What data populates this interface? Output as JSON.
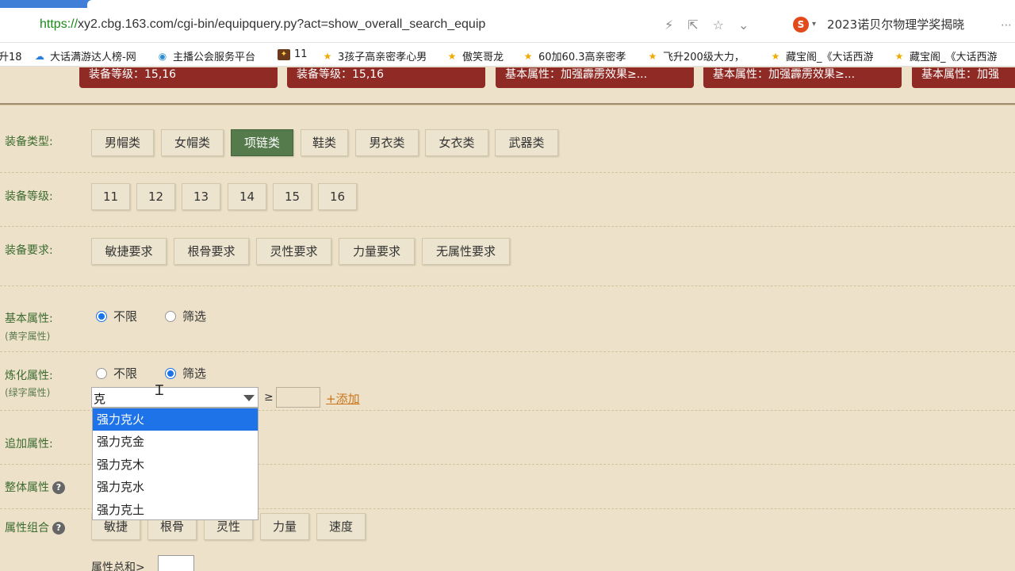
{
  "browser": {
    "url_proto": "https://",
    "url_rest": "xy2.cbg.163.com/cgi-bin/equipquery.py?act=show_overall_search_equip",
    "search_text": "2023诺贝尔物理学奖揭晓",
    "bookmarks": [
      {
        "icon": "cloud-icon",
        "label": "大话满游达人榜-网"
      },
      {
        "icon": "globe-icon",
        "label": "主播公会服务平台"
      },
      {
        "icon": "game-icon",
        "label": "11"
      },
      {
        "icon": "star-icon",
        "label": "3孩子高亲密孝心男"
      },
      {
        "icon": "star-icon",
        "label": "傲笑哥龙"
      },
      {
        "icon": "star-icon",
        "label": "60加60.3高亲密孝"
      },
      {
        "icon": "star-icon",
        "label": "飞升200级大力，"
      },
      {
        "icon": "star-icon",
        "label": "藏宝阁_《大话西游"
      },
      {
        "icon": "star-icon",
        "label": "藏宝阁_《大话西游"
      }
    ],
    "bookmark_left_fragment": "升18"
  },
  "top_tags": [
    "装备等级：15,16",
    "装备等级：15,16",
    "基本属性：加强霹雳效果≥...",
    "基本属性：加强霹雳效果≥...",
    "基本属性：加强"
  ],
  "filters": {
    "equip_type": {
      "label": "装备类型:",
      "options": [
        "男帽类",
        "女帽类",
        "项链类",
        "鞋类",
        "男衣类",
        "女衣类",
        "武器类"
      ],
      "selected": "项链类"
    },
    "equip_level": {
      "label": "装备等级:",
      "options": [
        "11",
        "12",
        "13",
        "14",
        "15",
        "16"
      ]
    },
    "equip_req": {
      "label": "装备要求:",
      "options": [
        "敏捷要求",
        "根骨要求",
        "灵性要求",
        "力量要求",
        "无属性要求"
      ]
    },
    "base_attr": {
      "label": "基本属性:",
      "sublabel": "(黄字属性)",
      "options": [
        "不限",
        "筛选"
      ],
      "selected": "不限"
    },
    "refine_attr": {
      "label": "炼化属性:",
      "sublabel": "(绿字属性)",
      "options": [
        "不限",
        "筛选"
      ],
      "selected": "筛选",
      "input_value": "克",
      "ge_symbol": "≥",
      "add_link": "+添加",
      "dropdown": [
        "强力克火",
        "强力克金",
        "强力克木",
        "强力克水",
        "强力克土"
      ],
      "highlighted": "强力克火"
    },
    "extra_attr": {
      "label": "追加属性:"
    },
    "overall_attr": {
      "label": "整体属性",
      "help": "?"
    },
    "attr_combo": {
      "label": "属性组合",
      "help": "?",
      "options": [
        "敏捷",
        "根骨",
        "灵性",
        "力量",
        "速度"
      ],
      "sum_label": "属性总和>"
    }
  },
  "colors": {
    "page_bg": "#ede2c9",
    "tag_red": "#8f2a24",
    "label_green": "#3c6a30",
    "active_btn": "#557a4b",
    "link_orange": "#c9741b",
    "highlight_blue": "#1e73e8"
  }
}
